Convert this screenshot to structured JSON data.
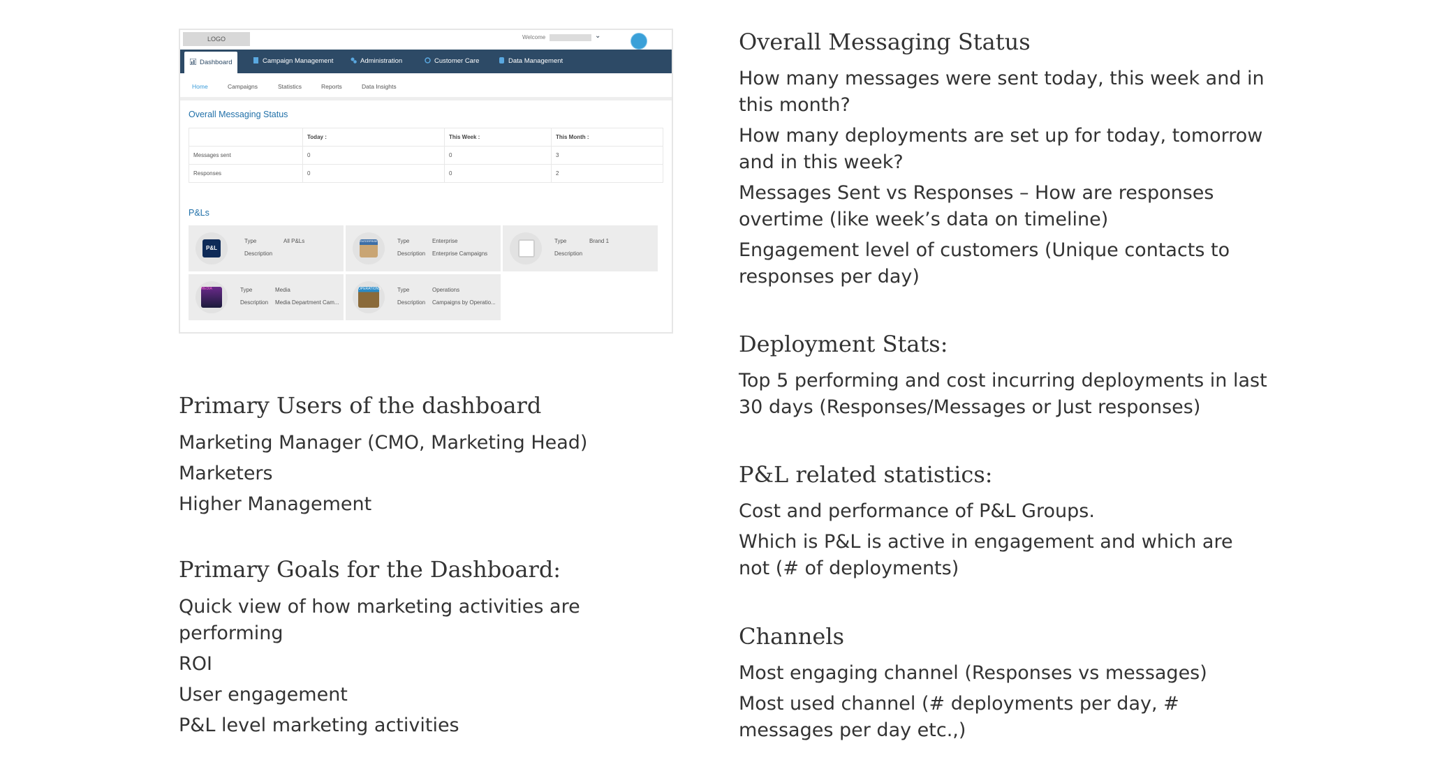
{
  "screenshot": {
    "logo": "LOGO",
    "welcome": "Welcome",
    "nav": [
      "Dashboard",
      "Campaign Management",
      "Administration",
      "Customer Care",
      "Data Management"
    ],
    "subnav": [
      "Home",
      "Campaigns",
      "Statistics",
      "Reports",
      "Data Insights"
    ],
    "overall_title": "Overall Messaging Status",
    "table": {
      "headers": [
        "",
        "Today :",
        "This Week :",
        "This Month :"
      ],
      "rows": [
        [
          "Messages sent",
          "0",
          "0",
          "3"
        ],
        [
          "Responses",
          "0",
          "0",
          "2"
        ]
      ]
    },
    "pl_title": "P&Ls",
    "type_label": "Type",
    "desc_label": "Description",
    "pl_cards": [
      {
        "badge": "P&L",
        "type": "All P&Ls",
        "description": ""
      },
      {
        "badge": "ENTERPRISE",
        "type": "Enterprise",
        "description": "Enterprise Campaigns"
      },
      {
        "badge": "",
        "type": "Brand 1",
        "description": ""
      },
      {
        "badge": "MEDIA",
        "type": "Media",
        "description": "Media Department Cam..."
      },
      {
        "badge": "OPERATIONS",
        "type": "Operations",
        "description": "Campaigns by Operatio..."
      }
    ]
  },
  "left": {
    "users_title": "Primary Users of the dashboard",
    "users": [
      "Marketing Manager (CMO, Marketing Head)",
      "Marketers",
      "Higher Management"
    ],
    "goals_title": "Primary Goals for the Dashboard:",
    "goals": [
      "Quick view of how marketing activities are performing",
      "ROI",
      "User engagement",
      "P&L level marketing activities"
    ]
  },
  "right": {
    "messaging_title": "Overall Messaging Status",
    "messaging": [
      "How many messages were sent today, this week and in this month?",
      "How many deployments are set up for today, tomorrow and in this week?",
      "Messages Sent vs Responses – How are responses overtime (like week’s data on timeline)",
      "Engagement level of customers (Unique contacts to responses per day)"
    ],
    "deployment_title": "Deployment Stats:",
    "deployment": [
      "Top 5 performing and cost incurring deployments in last 30 days (Responses/Messages or Just responses)"
    ],
    "pl_title": "P&L related statistics:",
    "pl": [
      "Cost and performance of P&L Groups.",
      "Which is P&L is active in engagement and which are not (# of deployments)"
    ],
    "channels_title": "Channels",
    "channels": [
      "Most engaging channel (Responses vs messages)",
      "Most used channel (# deployments per day, # messages per day etc.,)"
    ]
  },
  "colors": {
    "nav_bg": "#2d4a66",
    "title_blue": "#1f6fa8",
    "link_blue": "#3a9bd9",
    "text": "#333333"
  }
}
